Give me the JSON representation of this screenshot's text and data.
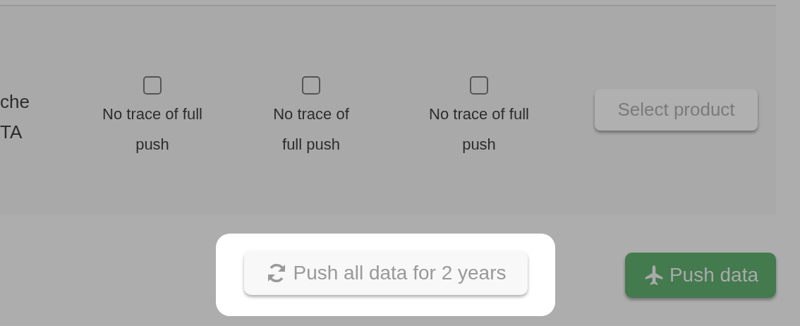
{
  "row": {
    "label_lines": [
      "che",
      "TA"
    ],
    "checkboxes": [
      {
        "label": "No trace of full push",
        "checked": false
      },
      {
        "label": "No trace of full push",
        "checked": false
      },
      {
        "label": "No trace of full push",
        "checked": false
      }
    ],
    "button": "Select product"
  },
  "push_all_button": {
    "label": "Push all data for 2 years",
    "highlighted": true
  },
  "push_button": {
    "label": "Push data"
  }
}
